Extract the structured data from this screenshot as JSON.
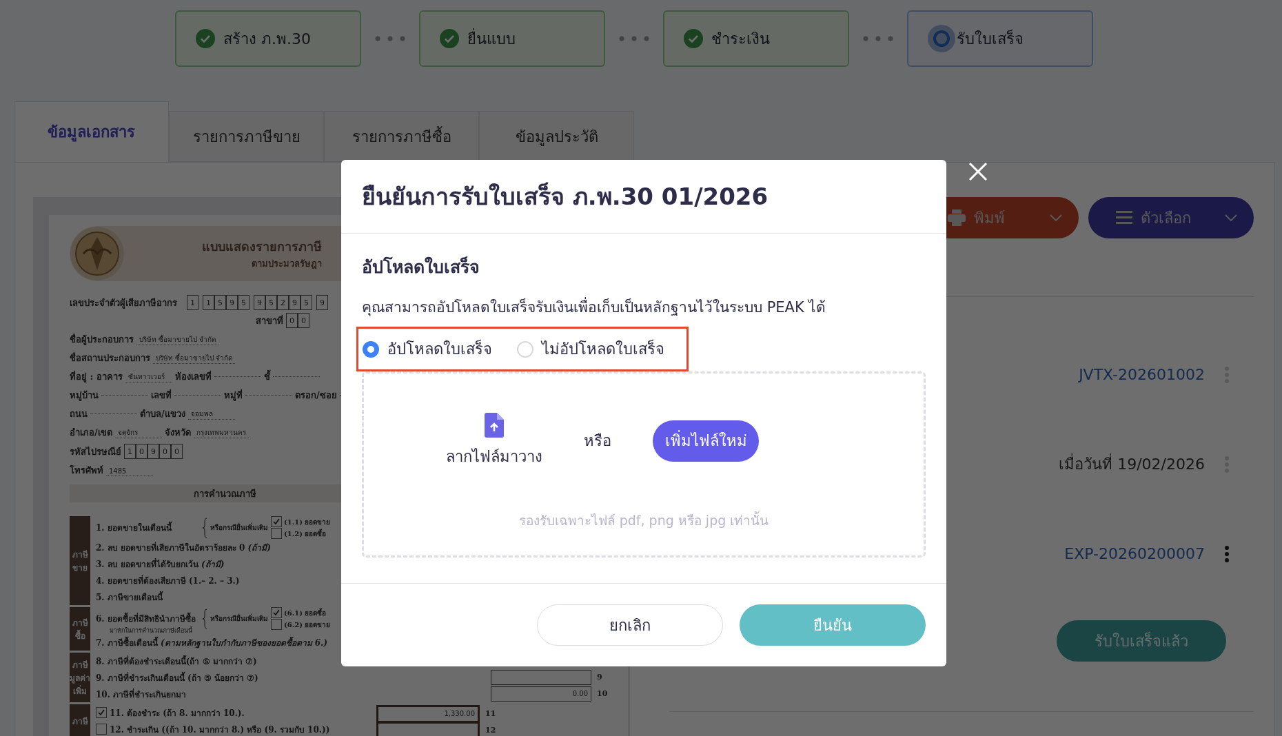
{
  "steps": [
    {
      "label": "สร้าง ภ.พ.30",
      "completed": true
    },
    {
      "label": "ยื่นแบบ",
      "completed": true
    },
    {
      "label": "ชำระเงิน",
      "completed": true
    },
    {
      "label": "รับใบเสร็จ",
      "completed": false
    }
  ],
  "tabs": [
    {
      "label": "ข้อมูลเอกสาร",
      "selected": true
    },
    {
      "label": "รายการภาษีขาย",
      "selected": false
    },
    {
      "label": "รายการภาษีซื้อ",
      "selected": false
    },
    {
      "label": "ข้อมูลประวัติ",
      "selected": false
    }
  ],
  "form": {
    "title": "แบบแสดงรายการภาษี",
    "subtitle": "ตามประมวลรัษฎา",
    "taxid_label": "เลขประจำตัวผู้เสียภาษีอากร",
    "taxid_groups": [
      [
        "1"
      ],
      [
        "1",
        "5",
        "9",
        "5"
      ],
      [
        "9",
        "5",
        "2",
        "9",
        "5"
      ],
      [
        "9"
      ]
    ],
    "branch_label": "สาขาที่",
    "branch_digits": [
      "0",
      "0"
    ],
    "lines": [
      [
        {
          "label": "ชื่อผู้ประกอบการ",
          "value": "บริษัท ซื้อมาขายไป จำกัด"
        }
      ],
      [
        {
          "label": "ชื่อสถานประกอบการ",
          "value": "บริษัท ซื้อมาขายไป จำกัด"
        }
      ],
      [
        {
          "label": "ที่อยู่ : อาคาร",
          "value": "ซันทาวเวอร์"
        },
        {
          "label": "ห้องเลขที่"
        },
        {
          "label": "ชั้"
        }
      ],
      [
        {
          "label": "หมู่บ้าน"
        },
        {
          "label": "เลขที่"
        },
        {
          "label": "หมู่ที่"
        },
        {
          "label": "ตรอก/ซอย"
        }
      ],
      [
        {
          "label": "ถนน"
        },
        {
          "label": "ตำบล/แขวง",
          "value": "จอมพล"
        }
      ],
      [
        {
          "label": "อำเภอ/เขต",
          "value": "จตุจักร"
        },
        {
          "label": "จังหวัด",
          "value": "กรุงเทพมหานคร"
        }
      ]
    ],
    "postcode_label": "รหัสไปรษณีย์",
    "postcode_digits": [
      "1",
      "0",
      "9",
      "0",
      "0"
    ],
    "phone_label": "โทรศัพท์",
    "phone": "1485",
    "calc_title": "การคำนวณภาษี",
    "groups": [
      {
        "label": [
          "ภาษี",
          "ขาย"
        ],
        "items": [
          {
            "text": "1. ยอดขายในเดือนนี้",
            "brace": "หรือกรณียื่นเพิ่มเติม",
            "options": [
              {
                "label": "(1.1) ยอดขาย",
                "checked": true
              },
              {
                "label": "(1.2) ยอดซื้อ",
                "checked": false
              }
            ]
          },
          {
            "text": "2. ลบ ยอดขายที่เสียภาษีในอัตราร้อยละ 0 *(ถ้ามี)*"
          },
          {
            "text": "3. ลบ ยอดขายที่ได้รับยกเว้น *(ถ้ามี)*"
          },
          {
            "text": "4. ยอดขายที่ต้องเสียภาษี (1.– 2. – 3.)"
          },
          {
            "text": "5. ภาษีขายเดือนนี้"
          }
        ]
      },
      {
        "label": [
          "ภาษี",
          "ซื้อ"
        ],
        "items": [
          {
            "text": "6. ยอดซื้อที่มีสิทธินำภาษีซื้อ",
            "note": "มาหักในการคำนวณภาษีเดือนนี้",
            "brace": "หรือกรณียื่นเพิ่มเติม",
            "options": [
              {
                "label": "(6.1) ยอดซื้อ",
                "checked": true
              },
              {
                "label": "(6.2) ยอดขาย",
                "checked": false
              }
            ]
          },
          {
            "text": "7. ภาษีซื้อเดือนนี้ *(ตามหลักฐานใบกำกับภาษีของยอดซื้อตาม 6.)*"
          }
        ]
      },
      {
        "label": [
          "ภาษี",
          "มูลค่า",
          "เพิ่ม"
        ],
        "items": [
          {
            "text": "8. ภาษีที่ต้องชำระเดือนนี้(ถ้า ⑤ มากกว่า ⑦)"
          },
          {
            "text": "9. ภาษีที่ชำระเกินเดือนนี้ (ถ้า ⑤ น้อยกว่า ⑦)",
            "box": {
              "kind": "standard",
              "number": "9"
            }
          },
          {
            "text": "10. ภาษีที่ชำระเกินยกมา",
            "box": {
              "kind": "standard",
              "number": "10",
              "value": "0.00"
            }
          }
        ]
      },
      {
        "label": [
          "ภาษี"
        ],
        "items": [
          {
            "text": "11. ต้องชำระ (ถ้า 8. มากกว่า 10.).",
            "checked": true,
            "box": {
              "kind": "payable",
              "number": "11",
              "value": "1,330.00"
            }
          },
          {
            "text": "12. ชำระเกิน ((ถ้า 10. มากกว่า 8.) หรือ (9. รวมกับ 10.))",
            "checked": false,
            "box": {
              "kind": "payable",
              "number": "12"
            }
          }
        ]
      }
    ]
  },
  "actions": {
    "print": "พิมพ์",
    "options": "ตัวเลือก"
  },
  "references": [
    {
      "text": "JVTX-202601002",
      "kind": "link",
      "menu_enabled": false
    },
    {
      "text": "เมื่อวันที่ 19/02/2026",
      "kind": "date",
      "menu_enabled": false
    },
    {
      "text": "EXP-20260200007",
      "kind": "link",
      "menu_enabled": true
    }
  ],
  "received_button": "รับใบเสร็จแล้ว",
  "modal": {
    "title": "ยืนยันการรับใบเสร็จ ภ.พ.30 01/2026",
    "section_title": "อัปโหลดใบเสร็จ",
    "description": "คุณสามารถอัปโหลดใบเสร็จรับเงินเพื่อเก็บเป็นหลักฐานไว้ในระบบ PEAK ได้",
    "options": [
      {
        "label": "อัปโหลดใบเสร็จ",
        "selected": true
      },
      {
        "label": "ไม่อัปโหลดใบเสร็จ",
        "selected": false
      }
    ],
    "dropzone": {
      "drag_text": "ลากไฟล์มาวาง",
      "or_text": "หรือ",
      "add_button": "เพิ่มไฟล์ใหม่",
      "hint": "รองรับเฉพาะไฟล์ pdf, png หรือ jpg เท่านั้น"
    },
    "buttons": {
      "cancel": "ยกเลิก",
      "confirm": "ยืนยัน"
    }
  }
}
